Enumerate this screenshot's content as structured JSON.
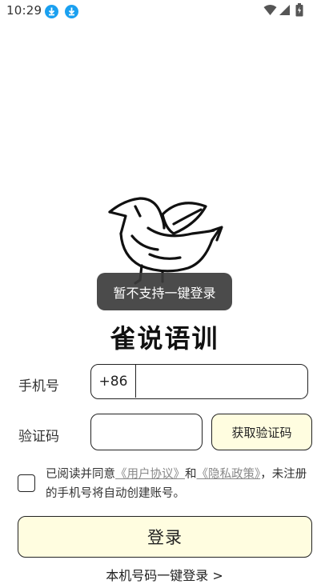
{
  "status_bar": {
    "time": "10:29",
    "icons": [
      "download-icon",
      "download-icon",
      "wifi-icon",
      "signal-icon",
      "battery-icon"
    ],
    "download_icon_color": "#1aa0f0"
  },
  "toast": {
    "text": "暂不支持一键登录"
  },
  "app": {
    "title": "雀说语训"
  },
  "form": {
    "phone_label": "手机号",
    "country_code": "+86",
    "phone_value": "",
    "code_label": "验证码",
    "code_value": "",
    "get_code_label": "获取验证码"
  },
  "agreement": {
    "checked": false,
    "prefix": "已阅读并同意",
    "user_agreement": "《用户协议》",
    "and": "和",
    "privacy_policy": "《隐私政策》",
    "suffix": "，未注册的手机号将自动创建账号。"
  },
  "actions": {
    "login_label": "登录",
    "one_key_login_label": "本机号码一键登录 >"
  },
  "colors": {
    "button_fill": "#fffde0",
    "border": "#222222",
    "link": "#888888",
    "toast_bg": "#3c3c3c"
  }
}
